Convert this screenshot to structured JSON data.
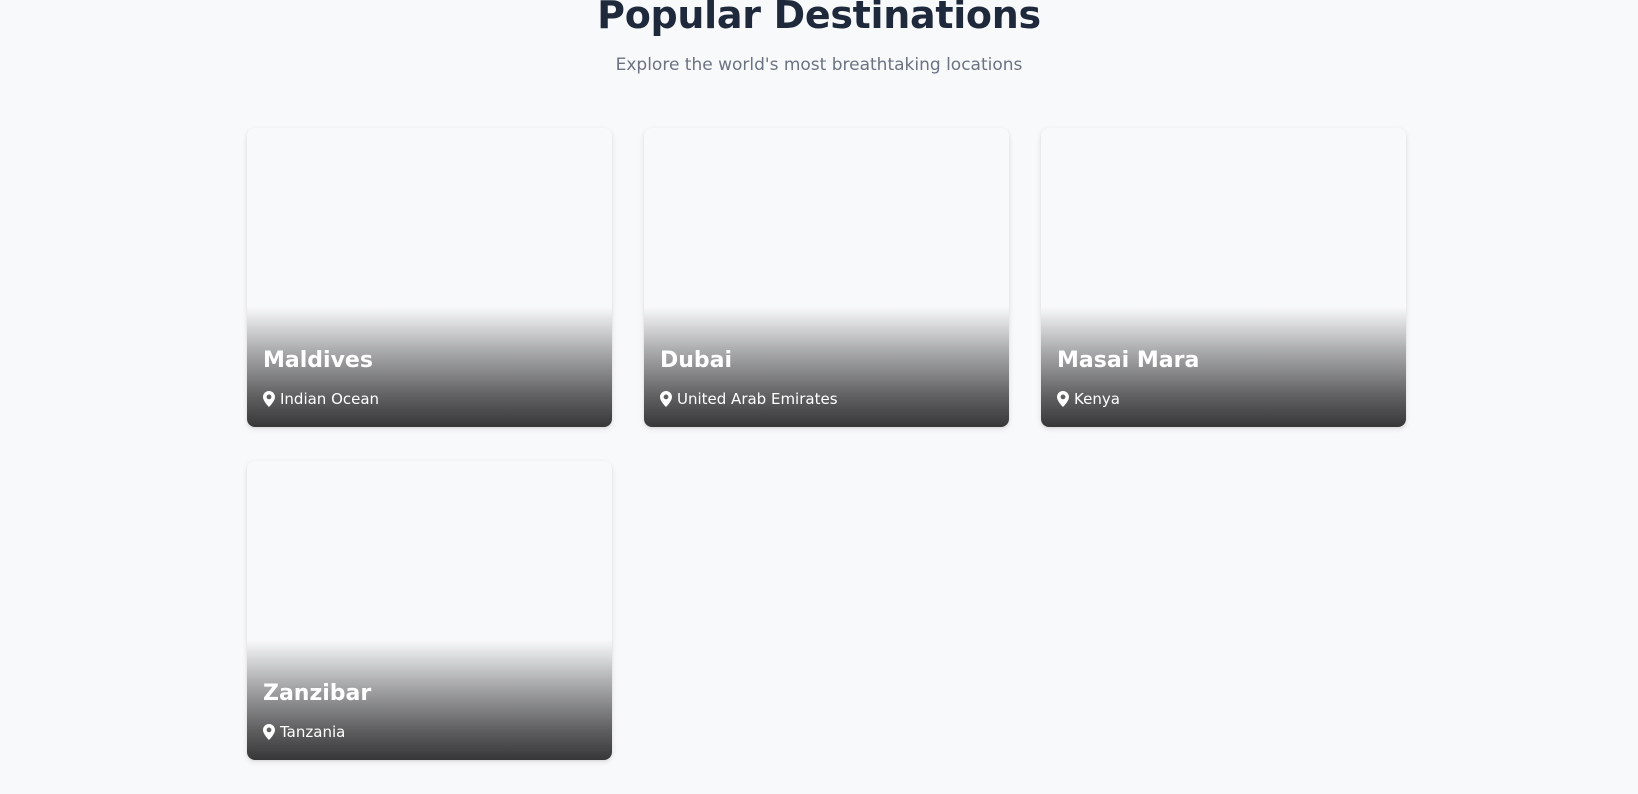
{
  "header": {
    "title": "Popular Destinations",
    "subtitle": "Explore the world's most breathtaking locations"
  },
  "destinations": [
    {
      "name": "Maldives",
      "location": "Indian Ocean",
      "icon": "map-pin-icon"
    },
    {
      "name": "Dubai",
      "location": "United Arab Emirates",
      "icon": "map-pin-icon"
    },
    {
      "name": "Masai Mara",
      "location": "Kenya",
      "icon": "map-pin-icon"
    },
    {
      "name": "Zanzibar",
      "location": "Tanzania",
      "icon": "map-pin-icon"
    }
  ],
  "colors": {
    "background": "#f8f9fb",
    "title": "#1e293b",
    "subtitle": "#6b7280",
    "card_text": "#ffffff"
  }
}
